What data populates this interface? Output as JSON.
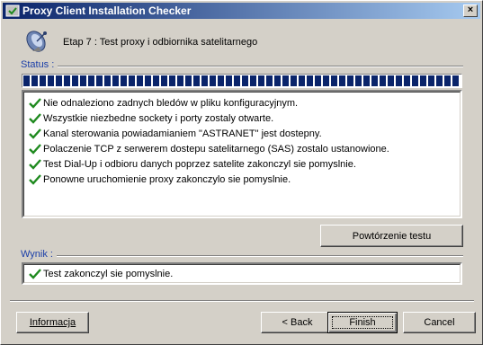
{
  "window": {
    "title": "Proxy Client Installation Checker",
    "close_label": "×"
  },
  "header": {
    "step_text": "Etap 7 : Test proxy i odbiornika satelitarnego",
    "icon": "satellite-dish-icon"
  },
  "status": {
    "label": "Status :",
    "progress": 1.0,
    "items": [
      "Nie odnaleziono zadnych bledów w pliku konfiguracyjnym.",
      "Wszystkie niezbedne sockety i porty zostaly otwarte.",
      "Kanal sterowania powiadamianiem \"ASTRANET\" jest dostepny.",
      "Polaczenie TCP z serwerem dostepu satelitarnego (SAS) zostalo ustanowione.",
      "Test Dial-Up i odbioru danych poprzez satelite zakonczyl sie pomyslnie.",
      "Ponowne uruchomienie proxy zakonczylo sie pomyslnie."
    ]
  },
  "retest_label": "Powtórzenie testu",
  "result": {
    "label": "Wynik :",
    "text": "Test zakonczyl sie pomyslnie."
  },
  "buttons": {
    "info": "Informacja",
    "back": "< Back",
    "finish": "Finish",
    "cancel": "Cancel"
  },
  "colors": {
    "check": "#1f8a1f",
    "progress": "#0a246a",
    "group_label": "#1a3ea8"
  }
}
